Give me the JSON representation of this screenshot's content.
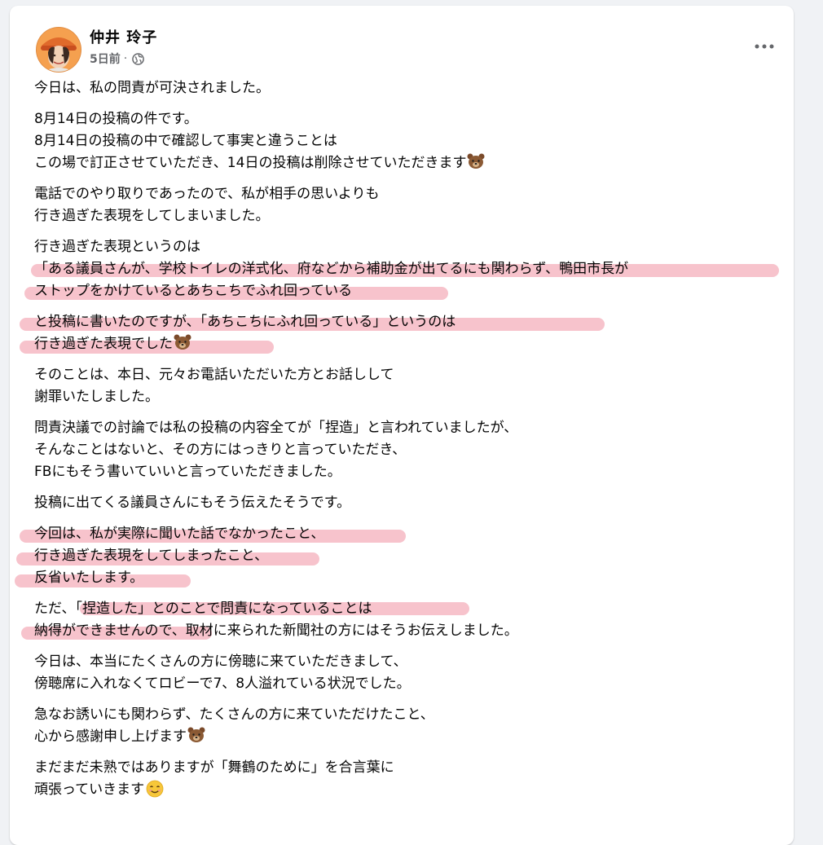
{
  "post": {
    "author": "仲井 玲子",
    "time": "5日前",
    "separator": "·",
    "paragraphs": [
      [
        "今日は、私の問責が可決されました。"
      ],
      [
        "8月14日の投稿の件です。",
        "8月14日の投稿の中で確認して事実と違うことは",
        "この場で訂正させていただき、14日の投稿は削除させていただきます"
      ],
      [
        "電話でのやり取りであったので、私が相手の思いよりも",
        "行き過ぎた表現をしてしまいました。"
      ],
      [
        "行き過ぎた表現というのは",
        "「ある議員さんが、学校トイレの洋式化、府などから補助金が出てるにも関わらず、鴨田市長が",
        "ストップをかけているとあちこちでふれ回っている"
      ],
      [
        "と投稿に書いたのですが、「あちこちにふれ回っている」というのは",
        "行き過ぎた表現でした"
      ],
      [
        "そのことは、本日、元々お電話いただいた方とお話しして",
        "謝罪いたしました。"
      ],
      [
        "問責決議での討論では私の投稿の内容全てが「捏造」と言われていましたが、",
        "そんなことはないと、その方にはっきりと言っていただき、",
        "FBにもそう書いていいと言っていただきました。"
      ],
      [
        "投稿に出てくる議員さんにもそう伝えたそうです。"
      ],
      [
        "今回は、私が実際に聞いた話でなかったこと、",
        "行き過ぎた表現をしてしまったこと、",
        "反省いたします。"
      ],
      [
        "ただ、「捏造した」とのことで問責になっていることは",
        "納得ができませんので、取材に来られた新聞社の方にはそうお伝えしました。"
      ],
      [
        "今日は、本当にたくさんの方に傍聴に来ていただきまして、",
        "傍聴席に入れなくてロビーで7、8人溢れている状況でした。"
      ],
      [
        "急なお誘いにも関わらず、たくさんの方に来ていただけたこと、",
        "心から感謝申し上げます"
      ],
      [
        "まだまだ未熟ではありますが「舞鶴のために」を合言葉に",
        "頑張っていきます"
      ]
    ]
  },
  "icons": {
    "globe": "globe-icon",
    "more": "more-options-icon",
    "bear": "bear-face-emoji",
    "smile": "smiling-face-emoji"
  },
  "colors": {
    "highlight": "#f7c3cc",
    "meta": "#65676b",
    "text": "#050505",
    "background": "#f0f2f5"
  }
}
